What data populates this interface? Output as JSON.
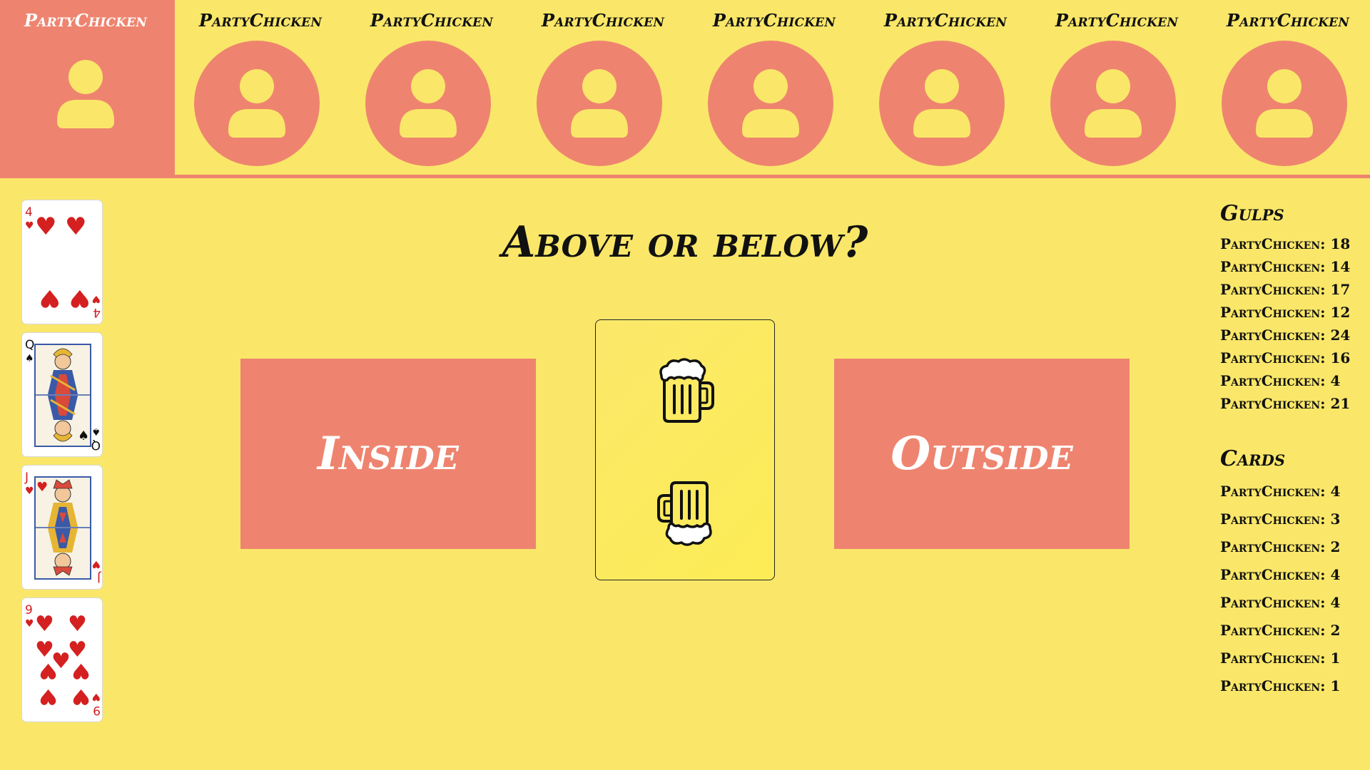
{
  "players": [
    {
      "name": "PartyChicken",
      "active": true
    },
    {
      "name": "PartyChicken",
      "active": false
    },
    {
      "name": "PartyChicken",
      "active": false
    },
    {
      "name": "PartyChicken",
      "active": false
    },
    {
      "name": "PartyChicken",
      "active": false
    },
    {
      "name": "PartyChicken",
      "active": false
    },
    {
      "name": "PartyChicken",
      "active": false
    },
    {
      "name": "PartyChicken",
      "active": false
    }
  ],
  "hand": [
    {
      "rank": "4",
      "suit": "hearts"
    },
    {
      "rank": "Q",
      "suit": "spades"
    },
    {
      "rank": "J",
      "suit": "hearts"
    },
    {
      "rank": "9",
      "suit": "hearts"
    }
  ],
  "question": "Above or below?",
  "buttons": {
    "inside": "Inside",
    "outside": "Outside"
  },
  "draw_card": {
    "icon_top": "beer-mug-icon",
    "icon_bottom": "beer-mug-upside-down-icon"
  },
  "gulps": {
    "heading": "Gulps",
    "rows": [
      "PartyChicken: 18",
      "PartyChicken: 14",
      "PartyChicken: 17",
      "PartyChicken: 12",
      "PartyChicken: 24",
      "PartyChicken: 16",
      "PartyChicken: 4",
      "PartyChicken: 21"
    ]
  },
  "cards": {
    "heading": "Cards",
    "rows": [
      "PartyChicken: 4",
      "PartyChicken: 3",
      "PartyChicken: 2",
      "PartyChicken: 4",
      "PartyChicken: 4",
      "PartyChicken: 2",
      "PartyChicken: 1",
      "PartyChicken: 1"
    ]
  },
  "colors": {
    "background": "#fae769",
    "accent": "#ee846f",
    "heart": "#d42020",
    "text": "#111111"
  }
}
